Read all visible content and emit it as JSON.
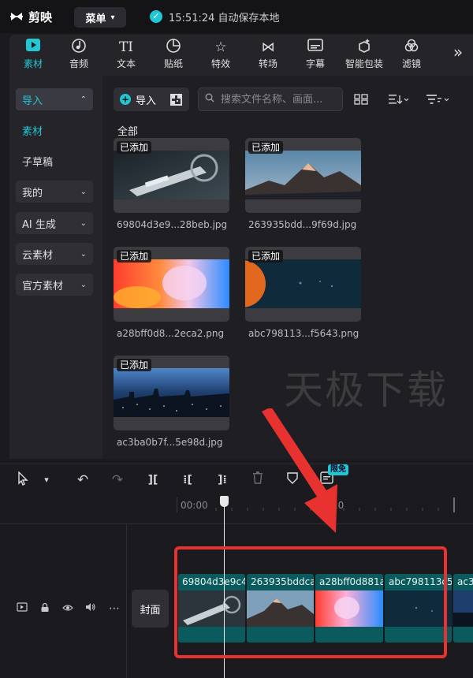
{
  "app": {
    "logo": "剪映",
    "menu_label": "菜单",
    "autosave": "15:51:24 自动保存本地"
  },
  "tabs": [
    {
      "label": "素材",
      "icon": "media-play-icon",
      "active": true
    },
    {
      "label": "音频",
      "icon": "music-note-icon"
    },
    {
      "label": "文本",
      "icon": "text-icon"
    },
    {
      "label": "贴纸",
      "icon": "sticker-icon"
    },
    {
      "label": "特效",
      "icon": "effects-star-icon"
    },
    {
      "label": "转场",
      "icon": "transition-icon"
    },
    {
      "label": "字幕",
      "icon": "subtitle-icon"
    },
    {
      "label": "智能包装",
      "icon": "smart-package-icon"
    },
    {
      "label": "滤镜",
      "icon": "filter-icon"
    }
  ],
  "tabs_more": "»",
  "sidebar": {
    "items": [
      {
        "label": "导入",
        "chevron": "⌃"
      },
      {
        "label": "素材"
      },
      {
        "label": "子草稿"
      },
      {
        "label": "我的",
        "chevron": "⌄"
      },
      {
        "label": "AI 生成",
        "chevron": "⌄"
      },
      {
        "label": "云素材",
        "chevron": "⌄"
      },
      {
        "label": "官方素材",
        "chevron": "⌄"
      }
    ]
  },
  "panel": {
    "import_label": "导入",
    "search_placeholder": "搜索文件名称、画面...",
    "section_label": "全部",
    "watermark": "天极下载"
  },
  "media": [
    {
      "name": "69804d3e9...28beb.jpg",
      "badge": "已添加"
    },
    {
      "name": "263935bdd...9f69d.jpg",
      "badge": "已添加"
    },
    {
      "name": "a28bff0d8...2eca2.png",
      "badge": "已添加"
    },
    {
      "name": "abc798113...f5643.png",
      "badge": "已添加"
    },
    {
      "name": "ac3ba0b7f...5e98d.jpg",
      "badge": "已添加"
    }
  ],
  "timeline": {
    "free_badge": "限免",
    "ticks": [
      "00:00",
      "10"
    ],
    "cover_label": "封面",
    "clips": [
      {
        "name": "69804d3e9c4"
      },
      {
        "name": "263935bddca"
      },
      {
        "name": "a28bff0d881a"
      },
      {
        "name": "abc798113c5"
      },
      {
        "name": "ac3"
      }
    ]
  },
  "colors": {
    "accent": "#22c7d6",
    "clip": "#0b5a5d",
    "highlight": "#e8322f"
  }
}
